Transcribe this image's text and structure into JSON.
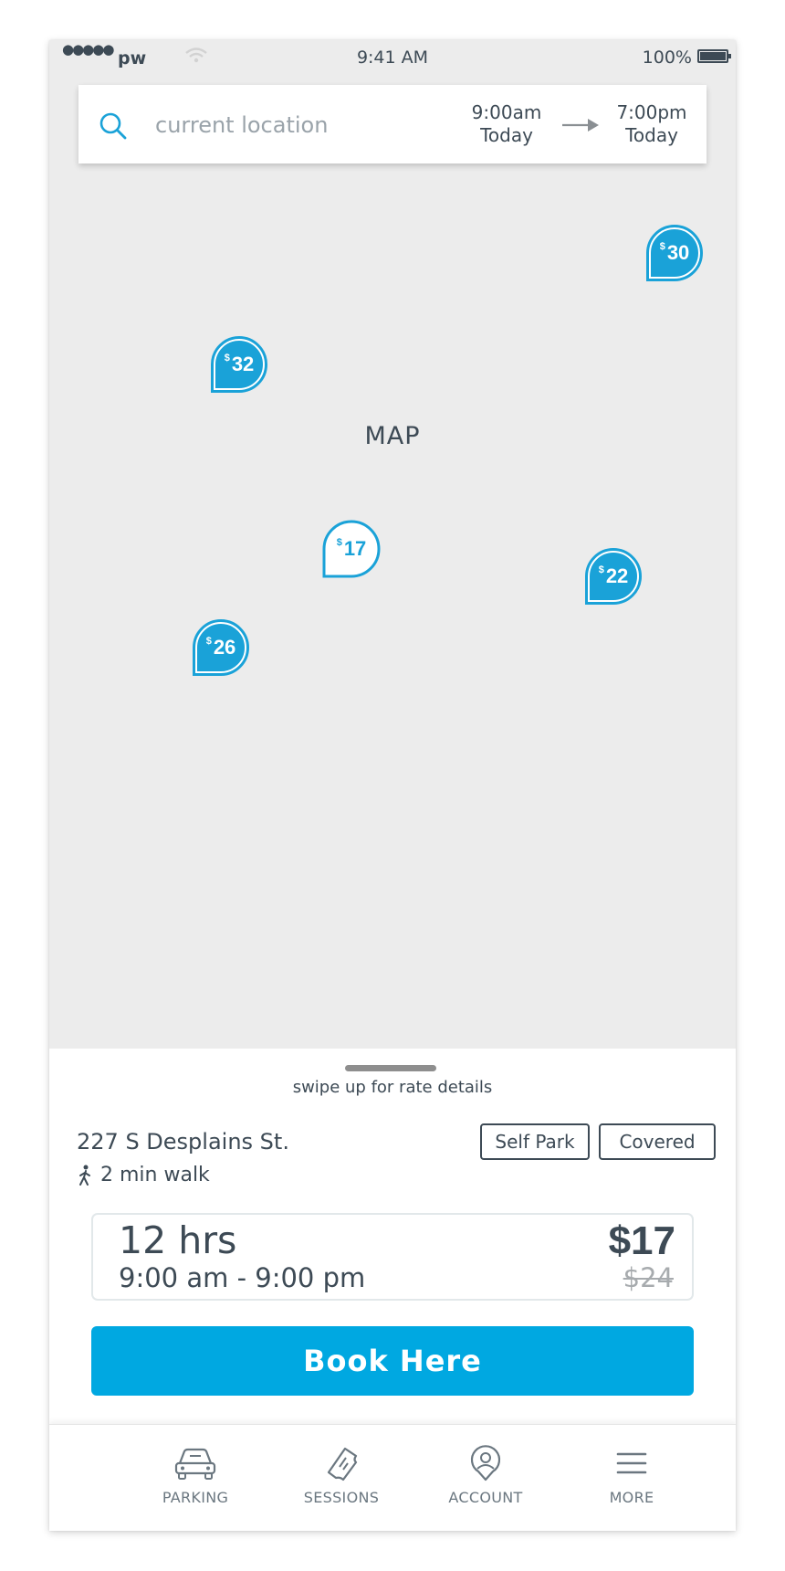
{
  "status_bar": {
    "dots": "●●●●●",
    "carrier": "pw",
    "time": "9:41 AM",
    "battery": "100%"
  },
  "search": {
    "placeholder": "current location",
    "start_time": "9:00am",
    "start_day": "Today",
    "end_time": "7:00pm",
    "end_day": "Today"
  },
  "map": {
    "label": "MAP",
    "currency": "$",
    "pins": [
      {
        "id": "pin-30",
        "price": "30",
        "selected": false
      },
      {
        "id": "pin-32",
        "price": "32",
        "selected": false
      },
      {
        "id": "pin-17",
        "price": "17",
        "selected": true
      },
      {
        "id": "pin-22",
        "price": "22",
        "selected": false
      },
      {
        "id": "pin-26",
        "price": "26",
        "selected": false
      }
    ],
    "colors": {
      "pin_fill": "#1aa2d8",
      "pin_selected_fill": "#ffffff"
    }
  },
  "sheet": {
    "swipe_hint": "swipe up for rate details",
    "address": "227 S Desplains St.",
    "walk": "2 min walk",
    "tags": [
      "Self Park",
      "Covered"
    ],
    "rate": {
      "hours": "12 hrs",
      "window": "9:00 am - 9:00 pm",
      "price": "$17",
      "old_price": "$24"
    },
    "book_label": "Book Here",
    "colors": {
      "accent": "#00a8e1"
    }
  },
  "tabbar": {
    "tabs": [
      {
        "label": "PARKING",
        "icon": "car-icon"
      },
      {
        "label": "SESSIONS",
        "icon": "ticket-icon"
      },
      {
        "label": "ACCOUNT",
        "icon": "user-pin-icon"
      },
      {
        "label": "MORE",
        "icon": "menu-icon"
      }
    ]
  }
}
